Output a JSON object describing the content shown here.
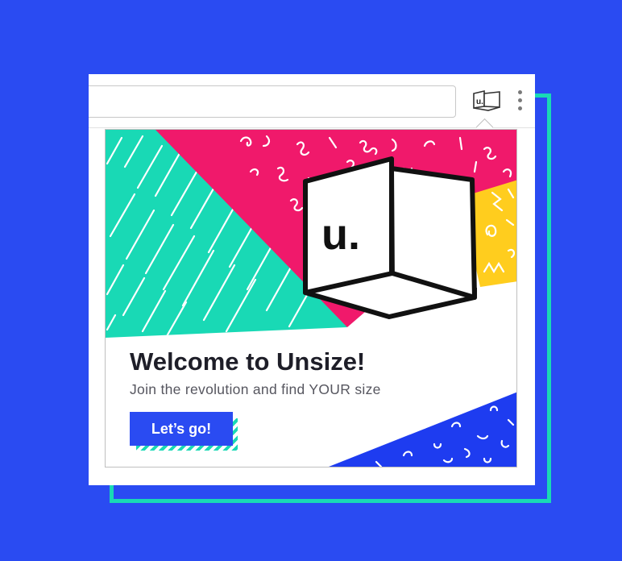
{
  "toolbar": {
    "omnibox_value": "",
    "extension_icon": "unsize-extension-icon",
    "menu_icon": "kebab-menu-icon"
  },
  "popup": {
    "logo_text": "u.",
    "title": "Welcome to Unsize!",
    "subtitle": "Join the revolution and find YOUR size",
    "cta_label": "Let’s go!"
  },
  "colors": {
    "background": "#2a4bf2",
    "teal": "#19d9b5",
    "pink": "#f0196b",
    "yellow": "#ffcd1e",
    "blue": "#1e3cf0",
    "text_dark": "#1e1e28"
  }
}
